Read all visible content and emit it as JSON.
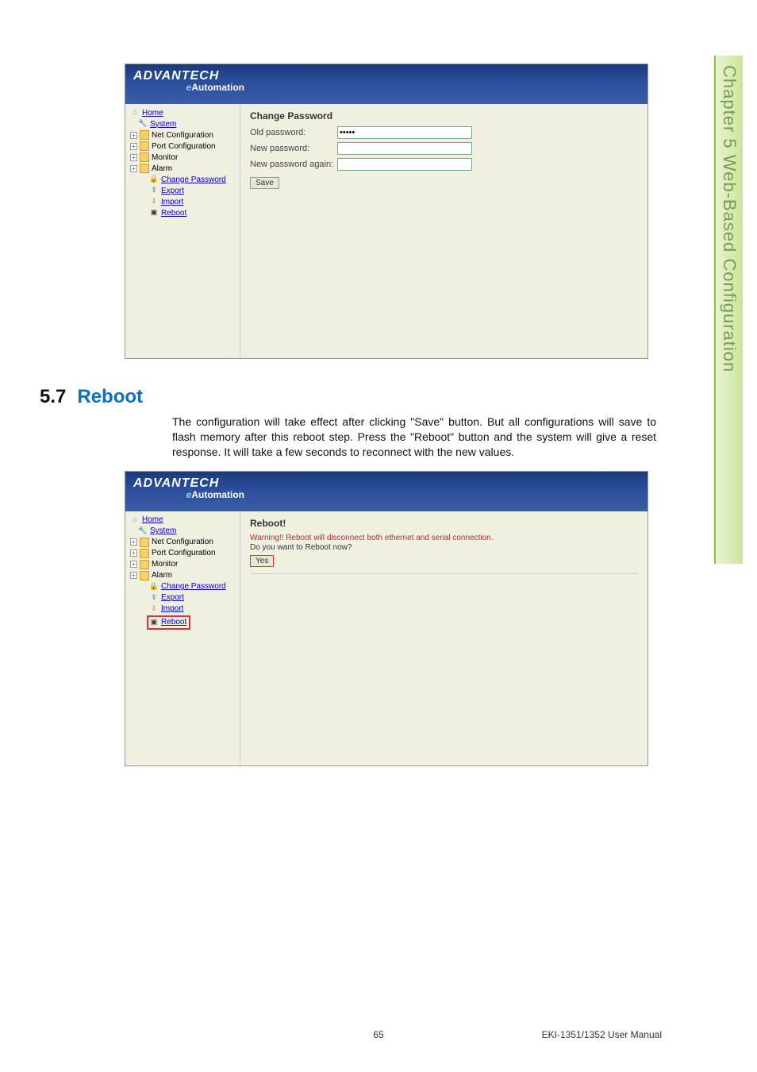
{
  "side_tab": "Chapter 5  Web-Based Configuration",
  "brand": "ADVANTECH",
  "subbrand_prefix": "e",
  "subbrand": "Automation",
  "tree": {
    "home": "Home",
    "system": "System",
    "net_config": "Net Configuration",
    "port_config": "Port Configuration",
    "monitor": "Monitor",
    "alarm": "Alarm",
    "change_password": "Change Password",
    "export": "Export",
    "import": "Import",
    "reboot": "Reboot"
  },
  "change_pw": {
    "heading": "Change Password",
    "old_label": "Old password:",
    "old_value": "•••••",
    "new_label": "New password:",
    "new_again_label": "New password again:",
    "save_btn": "Save"
  },
  "section": {
    "num": "5.7",
    "title": "Reboot",
    "text": "The configuration will take effect after clicking \"Save\" button. But all configurations will save to flash memory after this reboot step. Press the \"Reboot\" button and the system will give a reset response. It will take a few seconds to reconnect with the new values."
  },
  "reboot_panel": {
    "heading": "Reboot!",
    "warning": "Warning!! Reboot will disconnect both ethernet and serial connection.",
    "question": "Do you want to Reboot now?",
    "yes_btn": "Yes"
  },
  "footer": {
    "page": "65",
    "manual": "EKI-1351/1352 User Manual"
  }
}
